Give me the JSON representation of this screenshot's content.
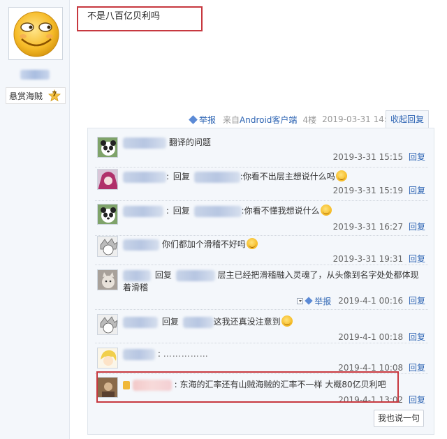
{
  "user": {
    "title": "悬赏海贼",
    "level": "7"
  },
  "post": {
    "text": "不是八百亿贝利吗",
    "report": "举报",
    "source_prefix": "来自",
    "source_link": "Android客户端",
    "floor": "4楼",
    "time": "2019-03-31 14:59",
    "collapse_label": "收起回复"
  },
  "replies": [
    {
      "prefix": "",
      "reply_word": "",
      "text": "翻译的问题",
      "time": "2019-3-31 15:15",
      "reply_label": "回复"
    },
    {
      "prefix": ":",
      "reply_word": "回复",
      "text": ":你看不出层主想说什么吗",
      "time": "2019-3-31 15:19",
      "reply_label": "回复"
    },
    {
      "prefix": ":",
      "reply_word": "回复",
      "text": ":你看不懂我想说什么",
      "time": "2019-3-31 16:27",
      "reply_label": "回复"
    },
    {
      "prefix": "",
      "reply_word": "",
      "text": "你们都加个滑稽不好吗",
      "time": "2019-3-31 19:31",
      "reply_label": "回复"
    },
    {
      "prefix": "",
      "reply_word": "回复",
      "text": "层主已经把滑稽融入灵魂了，从头像到名字处处都体现着滑稽",
      "time": "2019-4-1 00:16",
      "reply_label": "回复",
      "report": "举报"
    },
    {
      "prefix": "",
      "reply_word": "回复",
      "text": "这我还真没注意到",
      "time": "2019-4-1 00:18",
      "reply_label": "回复"
    },
    {
      "prefix": ":",
      "reply_word": "",
      "text": "……………",
      "time": "2019-4-1 10:08",
      "reply_label": "回复"
    },
    {
      "prefix": ":",
      "reply_word": "",
      "text": "东海的汇率还有山贼海贼的汇率不一样 大概80亿贝利吧",
      "time": "2019-4-1 13:02",
      "reply_label": "回复"
    }
  ],
  "say_button": "我也说一句"
}
